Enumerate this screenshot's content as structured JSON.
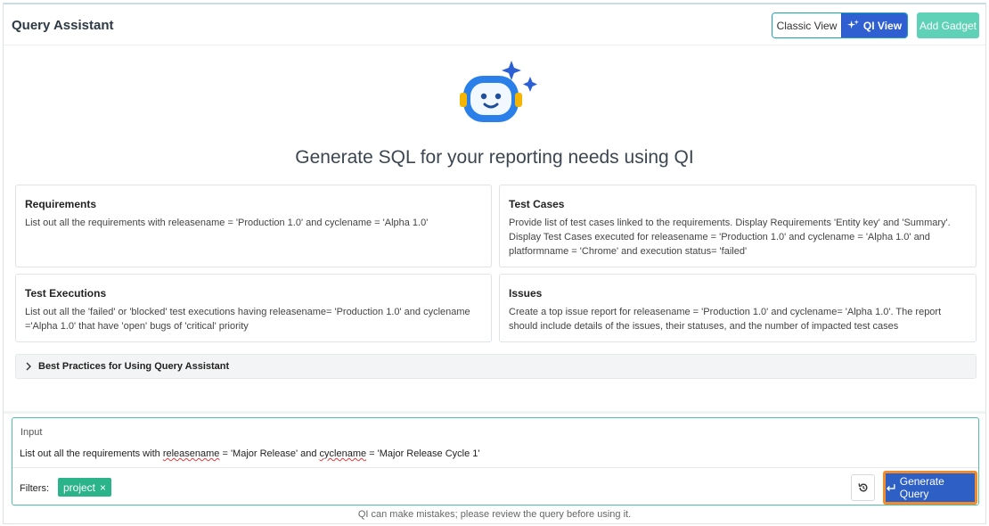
{
  "header": {
    "title": "Query Assistant",
    "classic_view": "Classic View",
    "qi_view": "QI View",
    "add_gadget": "Add Gadget"
  },
  "hero": {
    "headline": "Generate SQL for your reporting needs using QI"
  },
  "cards": [
    {
      "title": "Requirements",
      "text": "List out all the requirements with releasename = 'Production 1.0' and cyclename = 'Alpha 1.0'"
    },
    {
      "title": "Test Cases",
      "text": "Provide list of test cases linked to the requirements. Display Requirements 'Entity key' and 'Summary'. Display Test Cases executed for releasename = 'Production 1.0' and cyclename = 'Alpha 1.0' and platformname = 'Chrome' and execution status= 'failed'"
    },
    {
      "title": "Test Executions",
      "text": "List out all the 'failed' or 'blocked' test executions having releasename= 'Production 1.0' and cyclename ='Alpha 1.0' that have 'open' bugs of 'critical' priority"
    },
    {
      "title": "Issues",
      "text": "Create a top issue report for releasename = 'Production 1.0' and cyclename= 'Alpha 1.0'. The report should include details of the issues, their statuses, and the number of impacted test cases"
    }
  ],
  "accordion": {
    "label": "Best Practices for Using Query Assistant"
  },
  "input": {
    "label": "Input",
    "text_parts": [
      "List out all the requirements with ",
      "releasename",
      " = 'Major Release' and ",
      "cyclename",
      " = 'Major Release Cycle 1'"
    ],
    "filters_label": "Filters:",
    "filter_chip": "project",
    "chip_remove": "×",
    "generate_label": "Generate Query"
  },
  "footnote": "QI can make mistakes; please review the query before using it.",
  "colors": {
    "accent_blue": "#2f5fd0",
    "accent_green": "#2bb38a",
    "highlight_orange": "#f08c2b"
  },
  "icons": {
    "qi_view": "sparkle-icon",
    "accordion": "chevron-right-icon",
    "reset": "history-icon",
    "generate": "enter-arrow-icon",
    "robot": "robot-assistant-icon"
  }
}
